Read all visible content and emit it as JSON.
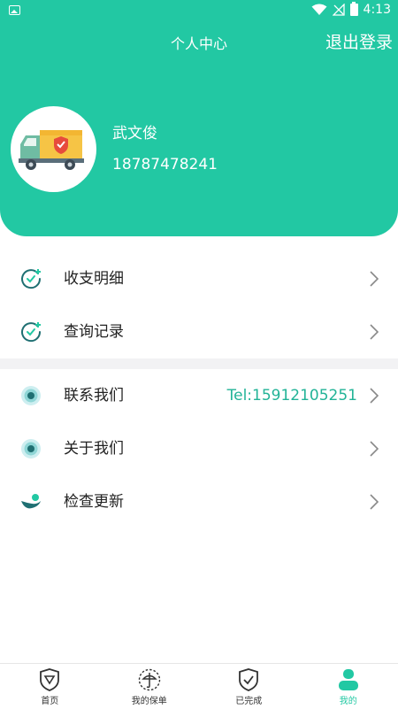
{
  "status_bar": {
    "time": "4:13"
  },
  "header": {
    "title": "个人中心",
    "logout_label": "退出登录",
    "username": "武文俊",
    "phone": "18787478241"
  },
  "menu_group_1": [
    {
      "label": "收支明细",
      "icon": "clock-plus-icon"
    },
    {
      "label": "查询记录",
      "icon": "clock-plus-icon"
    }
  ],
  "menu_group_2": [
    {
      "label": "联系我们",
      "icon": "circle-dot-icon",
      "extra": "Tel:15912105251"
    },
    {
      "label": "关于我们",
      "icon": "circle-dot-icon"
    },
    {
      "label": "检查更新",
      "icon": "update-icon"
    }
  ],
  "tabbar": [
    {
      "label": "首页",
      "icon": "shield-home-icon"
    },
    {
      "label": "我的保单",
      "icon": "policy-icon"
    },
    {
      "label": "已完成",
      "icon": "shield-check-icon"
    },
    {
      "label": "我的",
      "icon": "user-icon",
      "active": true
    }
  ],
  "colors": {
    "primary": "#22c8a3",
    "accent_text": "#22b397",
    "divider": "#f2f2f4"
  }
}
